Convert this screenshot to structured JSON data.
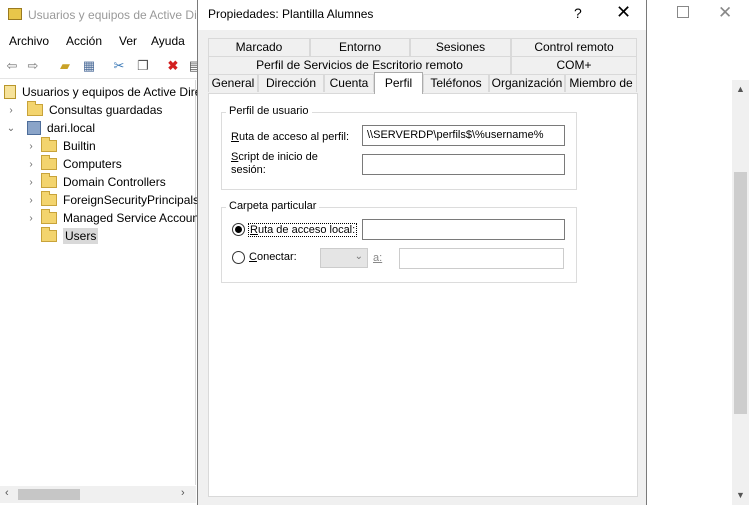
{
  "background_window": {
    "title": "Usuarios y equipos de Active Directory",
    "menu": [
      "Archivo",
      "Acción",
      "Ver",
      "Ayuda"
    ],
    "tree": {
      "root": "Usuarios y equipos de Active Directory",
      "saved_queries": "Consultas guardadas",
      "domain": "dari.local",
      "children": [
        "Builtin",
        "Computers",
        "Domain Controllers",
        "ForeignSecurityPrincipals",
        "Managed Service Accounts",
        "Users"
      ],
      "selected": "Users"
    }
  },
  "dialog": {
    "title": "Propiedades: Plantilla Alumnes",
    "help_glyph": "?",
    "close_glyph": "✕",
    "tabs_row1": [
      "Marcado",
      "Entorno",
      "Sesiones",
      "Control remoto"
    ],
    "tabs_row2": [
      "Perfil de Servicios de Escritorio remoto",
      "COM+"
    ],
    "tabs_row3": [
      "General",
      "Dirección",
      "Cuenta",
      "Perfil",
      "Teléfonos",
      "Organización",
      "Miembro de"
    ],
    "active_tab": "Perfil",
    "user_profile": {
      "legend": "Perfil de usuario",
      "profile_path_label": "Ruta de acceso al perfil:",
      "profile_path_value": "\\\\SERVERDP\\perfils$\\%username%",
      "logon_script_label_line1": "Script de inicio de",
      "logon_script_label_line2": "sesión:",
      "logon_script_value": ""
    },
    "home_folder": {
      "legend": "Carpeta particular",
      "local_path_label": "Ruta de acceso local:",
      "local_path_value": "",
      "local_path_checked": true,
      "connect_label": "Conectar:",
      "connect_checked": false,
      "drive_value": "",
      "to_label": "a:",
      "connect_value": ""
    }
  }
}
